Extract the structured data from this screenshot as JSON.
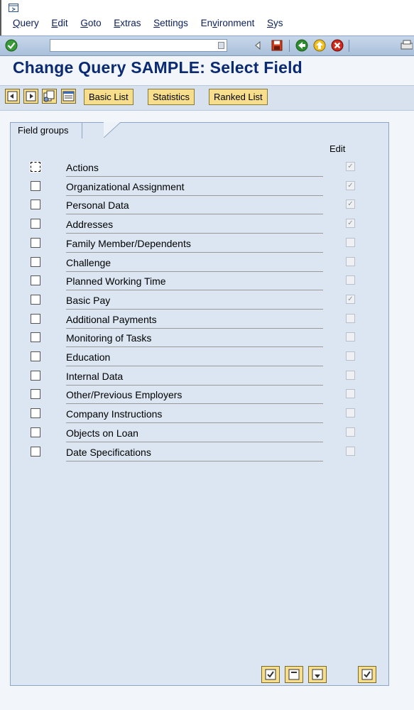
{
  "menubar": {
    "items": [
      {
        "label": "Query",
        "underline": "Q",
        "rest": "uery"
      },
      {
        "label": "Edit",
        "underline": "E",
        "rest": "dit"
      },
      {
        "label": "Goto",
        "underline": "G",
        "rest": "oto"
      },
      {
        "label": "Extras",
        "underline": "E",
        "rest": "xtras"
      },
      {
        "label": "Settings",
        "underline": "S",
        "rest": "ettings"
      },
      {
        "label": "Environment",
        "prefix": "En",
        "underline": "v",
        "rest": "ironment"
      },
      {
        "label": "Sys",
        "underline": "S",
        "rest": "ys"
      }
    ]
  },
  "systoolbar": {
    "command_value": "",
    "icons": [
      "enter-icon",
      "dropdown-icon",
      "back-arrow-icon",
      "save-icon",
      "back-icon",
      "exit-icon",
      "cancel-icon",
      "print-icon"
    ]
  },
  "title": "Change Query SAMPLE: Select Field",
  "apptoolbar": {
    "basic_list": "Basic List",
    "statistics": "Statistics",
    "ranked_list": "Ranked List"
  },
  "panel": {
    "tab_label": "Field groups",
    "edit_header": "Edit",
    "rows": [
      {
        "label": "Actions",
        "edit": true
      },
      {
        "label": "Organizational Assignment",
        "edit": true
      },
      {
        "label": "Personal Data",
        "edit": true
      },
      {
        "label": "Addresses",
        "edit": true
      },
      {
        "label": "Family Member/Dependents",
        "edit": false
      },
      {
        "label": "Challenge",
        "edit": false
      },
      {
        "label": "Planned Working Time",
        "edit": false
      },
      {
        "label": "Basic Pay",
        "edit": true
      },
      {
        "label": "Additional Payments",
        "edit": false
      },
      {
        "label": "Monitoring of Tasks",
        "edit": false
      },
      {
        "label": "Education",
        "edit": false
      },
      {
        "label": "Internal Data",
        "edit": false
      },
      {
        "label": "Other/Previous Employers",
        "edit": false
      },
      {
        "label": "Company Instructions",
        "edit": false
      },
      {
        "label": "Objects on Loan",
        "edit": false
      },
      {
        "label": "Date Specifications",
        "edit": false
      }
    ]
  },
  "colors": {
    "title": "#0a2a73",
    "button_bg": "#f6de8d",
    "panel_bg": "#dbe6f2"
  }
}
